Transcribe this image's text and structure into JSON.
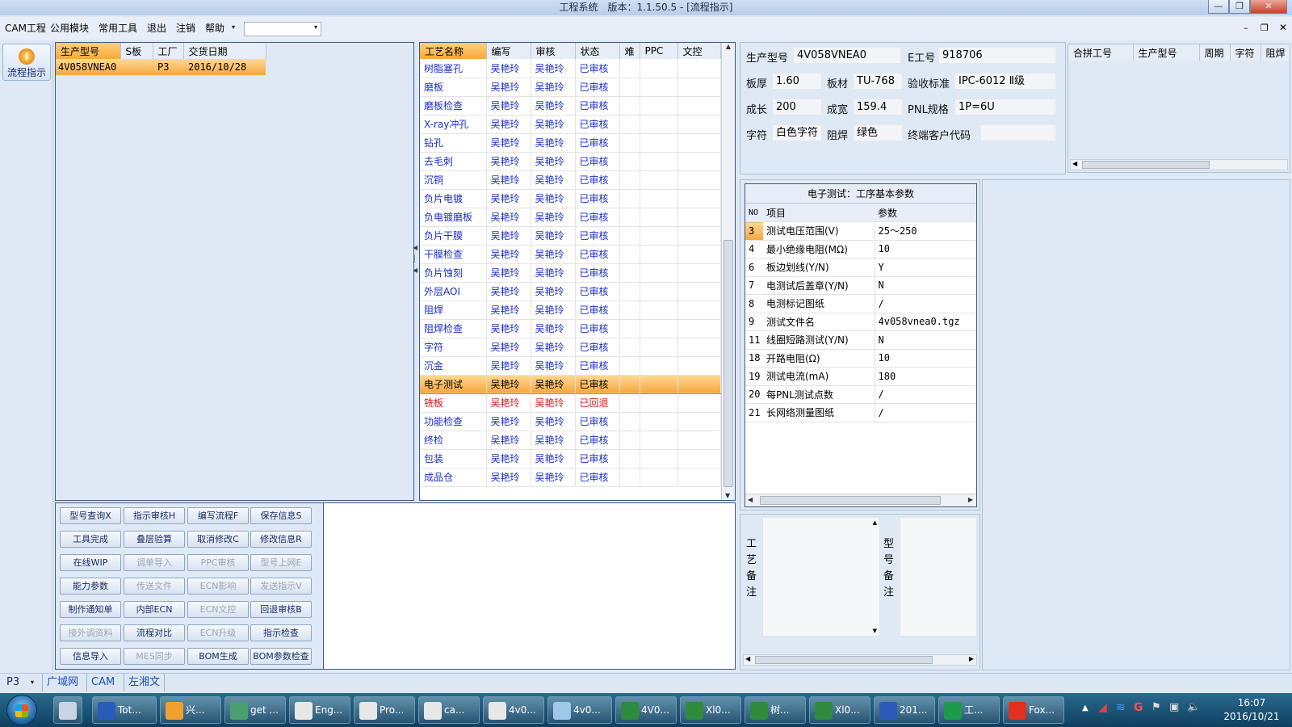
{
  "window": {
    "title": "工程系统　版本：1.1.50.5 - [流程指示]"
  },
  "menu": {
    "items": [
      "CAM工程",
      "公用模块",
      "常用工具",
      "退出",
      "注销",
      "帮助"
    ]
  },
  "side_button": {
    "label": "流程指示"
  },
  "orders": {
    "columns": [
      "生产型号",
      "S板",
      "工厂",
      "交货日期"
    ],
    "rows": [
      {
        "model": "4V058VNEA0",
        "s": "",
        "factory": "P3",
        "date": "2016/10/28"
      }
    ]
  },
  "process": {
    "columns": [
      "工艺名称",
      "编写",
      "审核",
      "状态",
      "难",
      "PPC",
      "文控"
    ],
    "rows": [
      {
        "name": "树脂塞孔",
        "writer": "吴艳玲",
        "auditor": "吴艳玲",
        "status": "已审核"
      },
      {
        "name": "磨板",
        "writer": "吴艳玲",
        "auditor": "吴艳玲",
        "status": "已审核"
      },
      {
        "name": "磨板检查",
        "writer": "吴艳玲",
        "auditor": "吴艳玲",
        "status": "已审核"
      },
      {
        "name": "X-ray冲孔",
        "writer": "吴艳玲",
        "auditor": "吴艳玲",
        "status": "已审核"
      },
      {
        "name": "钻孔",
        "writer": "吴艳玲",
        "auditor": "吴艳玲",
        "status": "已审核"
      },
      {
        "name": "去毛刺",
        "writer": "吴艳玲",
        "auditor": "吴艳玲",
        "status": "已审核"
      },
      {
        "name": "沉铜",
        "writer": "吴艳玲",
        "auditor": "吴艳玲",
        "status": "已审核"
      },
      {
        "name": "负片电镀",
        "writer": "吴艳玲",
        "auditor": "吴艳玲",
        "status": "已审核"
      },
      {
        "name": "负电镀磨板",
        "writer": "吴艳玲",
        "auditor": "吴艳玲",
        "status": "已审核"
      },
      {
        "name": "负片干膜",
        "writer": "吴艳玲",
        "auditor": "吴艳玲",
        "status": "已审核"
      },
      {
        "name": "干膜检查",
        "writer": "吴艳玲",
        "auditor": "吴艳玲",
        "status": "已审核"
      },
      {
        "name": "负片蚀刻",
        "writer": "吴艳玲",
        "auditor": "吴艳玲",
        "status": "已审核"
      },
      {
        "name": "外层AOI",
        "writer": "吴艳玲",
        "auditor": "吴艳玲",
        "status": "已审核"
      },
      {
        "name": "阻焊",
        "writer": "吴艳玲",
        "auditor": "吴艳玲",
        "status": "已审核"
      },
      {
        "name": "阻焊检查",
        "writer": "吴艳玲",
        "auditor": "吴艳玲",
        "status": "已审核"
      },
      {
        "name": "字符",
        "writer": "吴艳玲",
        "auditor": "吴艳玲",
        "status": "已审核"
      },
      {
        "name": "沉金",
        "writer": "吴艳玲",
        "auditor": "吴艳玲",
        "status": "已审核"
      },
      {
        "name": "电子测试",
        "writer": "吴艳玲",
        "auditor": "吴艳玲",
        "status": "已审核",
        "selected": true
      },
      {
        "name": "铣板",
        "writer": "吴艳玲",
        "auditor": "吴艳玲",
        "status": "已回退",
        "rejected": true
      },
      {
        "name": "功能检查",
        "writer": "吴艳玲",
        "auditor": "吴艳玲",
        "status": "已审核"
      },
      {
        "name": "终检",
        "writer": "吴艳玲",
        "auditor": "吴艳玲",
        "status": "已审核"
      },
      {
        "name": "包装",
        "writer": "吴艳玲",
        "auditor": "吴艳玲",
        "status": "已审核"
      },
      {
        "name": "成品仓",
        "writer": "吴艳玲",
        "auditor": "吴艳玲",
        "status": "已审核"
      }
    ]
  },
  "actions": [
    [
      {
        "t": "型号查询X",
        "e": true
      },
      {
        "t": "指示审核H",
        "e": true
      },
      {
        "t": "编写流程F",
        "e": true
      },
      {
        "t": "保存信息S",
        "e": true
      }
    ],
    [
      {
        "t": "工具完成",
        "e": true
      },
      {
        "t": "叠层验算",
        "e": true
      },
      {
        "t": "取消修改C",
        "e": true
      },
      {
        "t": "修改信息R",
        "e": true
      }
    ],
    [
      {
        "t": "在线WIP",
        "e": true
      },
      {
        "t": "调单导入",
        "e": false
      },
      {
        "t": "PPC审核",
        "e": false
      },
      {
        "t": "型号上网E",
        "e": false
      }
    ],
    [
      {
        "t": "能力参数",
        "e": true
      },
      {
        "t": "传送文件",
        "e": false
      },
      {
        "t": "ECN影响",
        "e": false
      },
      {
        "t": "发送指示V",
        "e": false
      }
    ],
    [
      {
        "t": "制作通知单",
        "e": true
      },
      {
        "t": "内部ECN",
        "e": true
      },
      {
        "t": "ECN文控",
        "e": false
      },
      {
        "t": "回退审核B",
        "e": true
      }
    ],
    [
      {
        "t": "接外调资料",
        "e": false
      },
      {
        "t": "流程对比",
        "e": true
      },
      {
        "t": "ECN升级",
        "e": false
      },
      {
        "t": "指示检查",
        "e": true
      }
    ],
    [
      {
        "t": "信息导入",
        "e": true
      },
      {
        "t": "MES同步",
        "e": false
      },
      {
        "t": "BOM生成",
        "e": true
      },
      {
        "t": "BOM参数检查",
        "e": true
      }
    ]
  ],
  "info": {
    "model_label": "生产型号",
    "model": "4V058VNEA0",
    "e_label": "E工号",
    "e_no": "918706",
    "thick_label": "板厚",
    "thick": "1.60",
    "mat_label": "板材",
    "mat": "TU-768",
    "std_label": "验收标准",
    "std": "IPC-6012 Ⅱ级",
    "len_label": "成长",
    "len": "200",
    "wid_label": "成宽",
    "wid": "159.4",
    "pnl_label": "PNL规格",
    "pnl": "1P=6U",
    "char_label": "字符",
    "char": "白色字符",
    "mask_label": "阻焊",
    "mask": "绿色",
    "cust_label": "终端客户代码",
    "cust": ""
  },
  "merge": {
    "columns": [
      "合拼工号",
      "生产型号",
      "周期",
      "字符",
      "阻焊"
    ]
  },
  "etest": {
    "title": "电子测试：工序基本参数",
    "columns": [
      "NO",
      "项目",
      "参数"
    ],
    "rows": [
      {
        "no": "3",
        "item": "测试电压范围(V)",
        "val": "25～250"
      },
      {
        "no": "4",
        "item": "最小绝缘电阻(MΩ)",
        "val": "10"
      },
      {
        "no": "6",
        "item": "板边划线(Y/N)",
        "val": "Y"
      },
      {
        "no": "7",
        "item": "电测试后盖章(Y/N)",
        "val": "N"
      },
      {
        "no": "8",
        "item": "电测标记图纸",
        "val": "/"
      },
      {
        "no": "9",
        "item": "测试文件名",
        "val": "4v058vnea0.tgz"
      },
      {
        "no": "11",
        "item": "线圈短路测试(Y/N)",
        "val": "N"
      },
      {
        "no": "18",
        "item": "开路电阻(Ω)",
        "val": "10"
      },
      {
        "no": "19",
        "item": "测试电流(mA)",
        "val": "180"
      },
      {
        "no": "20",
        "item": "每PNL测试点数",
        "val": "/"
      },
      {
        "no": "21",
        "item": "长网络测量图纸",
        "val": "/"
      }
    ]
  },
  "remarks": {
    "craft_label": "工艺备注",
    "model_label": "型号备注"
  },
  "status_bar": {
    "factory": "P3",
    "items": [
      "广域网",
      "CAM",
      "左湘文"
    ]
  },
  "taskbar": {
    "items": [
      "Tot...",
      "兴...",
      "get ...",
      "Eng...",
      "Pro...",
      "ca...",
      "4v0...",
      "4v0...",
      "4V0...",
      "Xl0...",
      "树...",
      "Xl0...",
      "201...",
      "工...",
      "Fox..."
    ],
    "time": "16:07",
    "date": "2016/10/21"
  }
}
